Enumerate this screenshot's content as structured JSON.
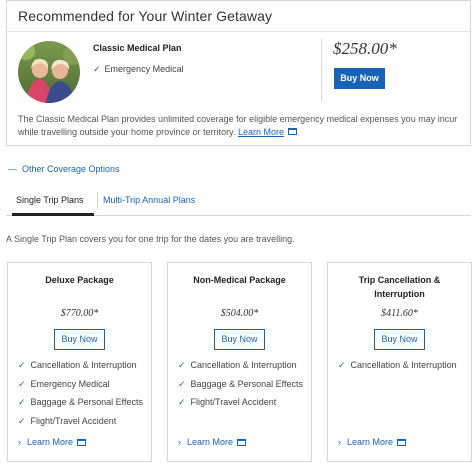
{
  "recommendation": {
    "title": "Recommended for Your Winter Getaway",
    "plan_name": "Classic Medical Plan",
    "feature": "Emergency Medical",
    "price": "$258.00*",
    "buy_label": "Buy Now",
    "description": "The Classic Medical Plan provides unlimited coverage for eligible emergency medical expenses you may incur while travelling outside your home province or territory.",
    "learn_more": "Learn More"
  },
  "other_coverage": "Other Coverage Options",
  "tabs": {
    "single": "Single Trip Plans",
    "multi": "Multi-Trip Annual Plans"
  },
  "intro": "A Single Trip Plan covers you for one trip for the dates you are travelling.",
  "cards": [
    {
      "title_line1": "Deluxe Package",
      "title_line2": "",
      "price": "$770.00*",
      "buy_label": "Buy Now",
      "features": [
        "Cancellation & Interruption",
        "Emergency Medical",
        "Baggage & Personal Effects",
        "Flight/Travel Accident"
      ],
      "learn_more": "Learn More"
    },
    {
      "title_line1": "Non-Medical Package",
      "title_line2": "",
      "price": "$504.00*",
      "buy_label": "Buy Now",
      "features": [
        "Cancellation & Interruption",
        "Baggage & Personal Effects",
        "Flight/Travel Accident"
      ],
      "learn_more": "Learn More"
    },
    {
      "title_line1": "Trip Cancellation &",
      "title_line2": "Interruption",
      "price": "$411.60*",
      "buy_label": "Buy Now",
      "features": [
        "Cancellation & Interruption"
      ],
      "learn_more": "Learn More"
    }
  ],
  "icons": {
    "check": "check-icon",
    "external": "external-link-icon",
    "chevron": "chevron-right-icon",
    "minus": "minus-icon"
  },
  "colors": {
    "accent": "#1763b8",
    "border": "#d6d6d6"
  }
}
